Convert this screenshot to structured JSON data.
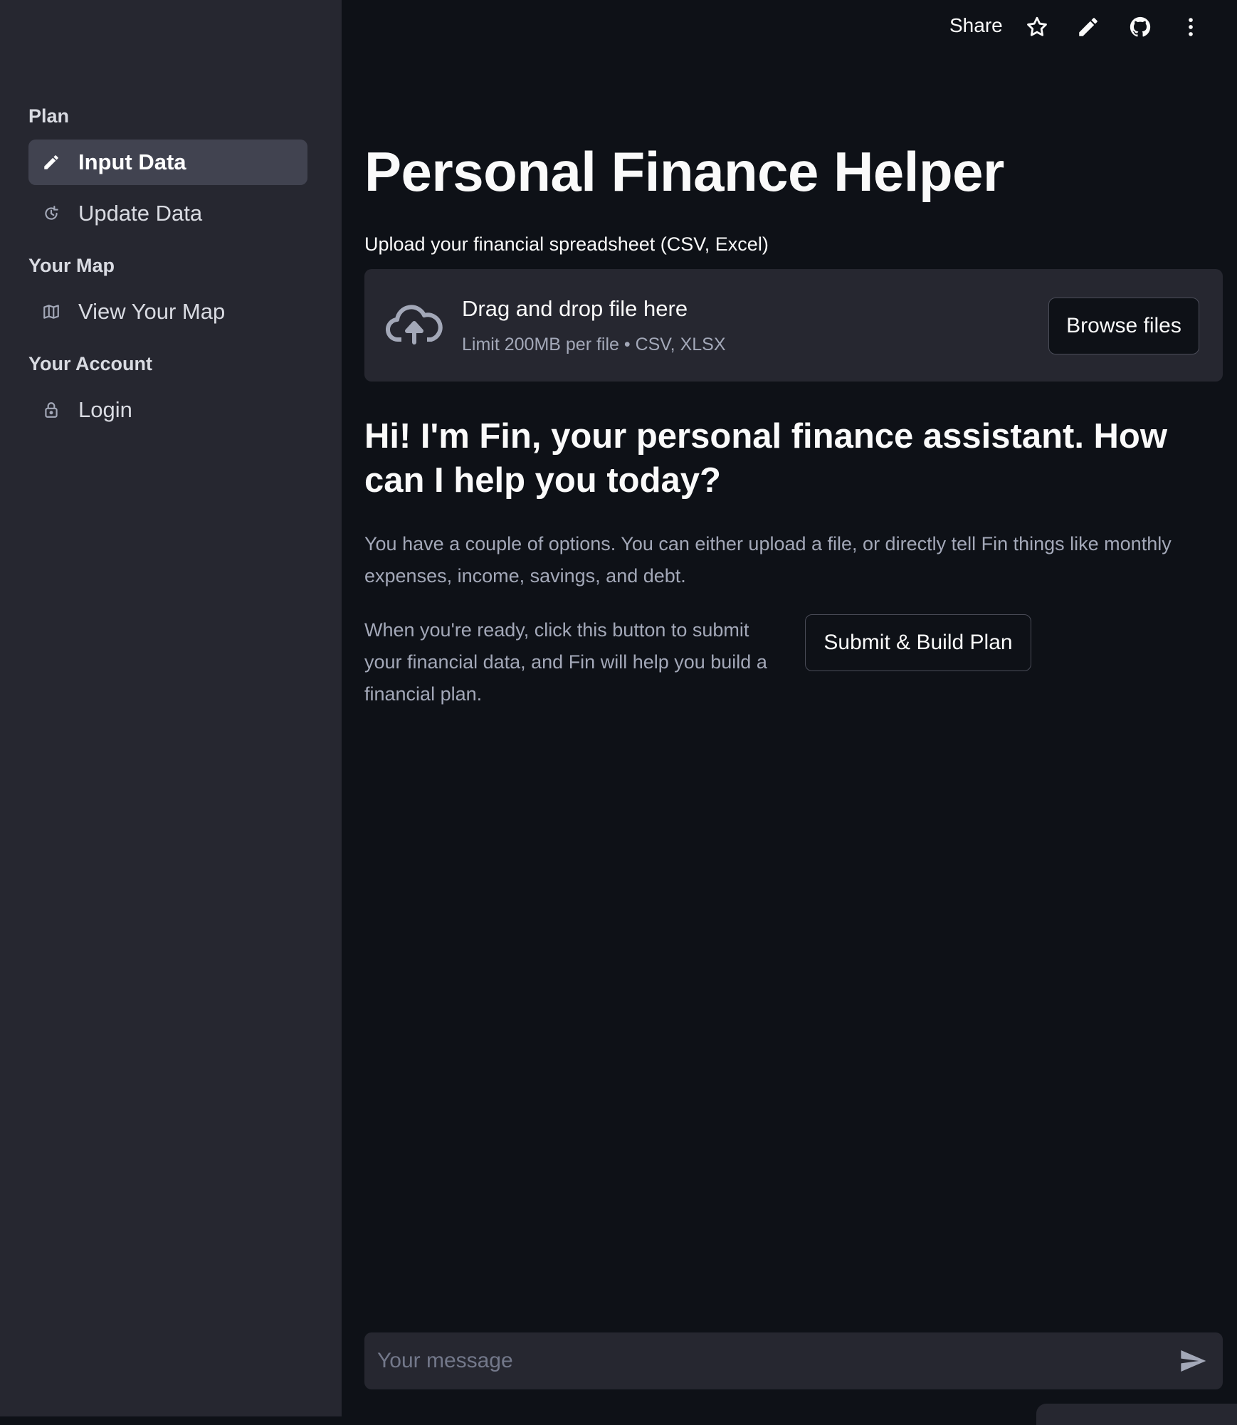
{
  "header": {
    "share_label": "Share",
    "icons": [
      "star-icon",
      "pencil-icon",
      "github-icon",
      "more-vertical-icon"
    ]
  },
  "sidebar": {
    "sections": [
      {
        "title": "Plan",
        "items": [
          {
            "label": "Input Data",
            "icon": "pencil-icon",
            "active": true
          },
          {
            "label": "Update Data",
            "icon": "history-icon",
            "active": false
          }
        ]
      },
      {
        "title": "Your Map",
        "items": [
          {
            "label": "View Your Map",
            "icon": "map-icon",
            "active": false
          }
        ]
      },
      {
        "title": "Your Account",
        "items": [
          {
            "label": "Login",
            "icon": "lock-icon",
            "active": false
          }
        ]
      }
    ]
  },
  "main": {
    "title": "Personal Finance Helper",
    "uploader": {
      "label": "Upload your financial spreadsheet (CSV, Excel)",
      "drop_title": "Drag and drop file here",
      "limit_text": "Limit 200MB per file • CSV, XLSX",
      "browse_label": "Browse files"
    },
    "greeting": "Hi! I'm Fin, your personal finance assistant. How can I help you today?",
    "options_text": "You have a couple of options. You can either upload a file, or directly tell Fin things like monthly expenses, income, savings, and debt.",
    "ready_text": "When you're ready, click this button to submit your financial data, and Fin will help you build a financial plan.",
    "submit_label": "Submit & Build Plan"
  },
  "chat": {
    "value": "",
    "placeholder": "Your message"
  },
  "colors": {
    "background": "#0e1117",
    "sidebar": "#262730",
    "active_item": "#414350",
    "text": "#fafafa",
    "muted_text": "#a3a8b8"
  }
}
